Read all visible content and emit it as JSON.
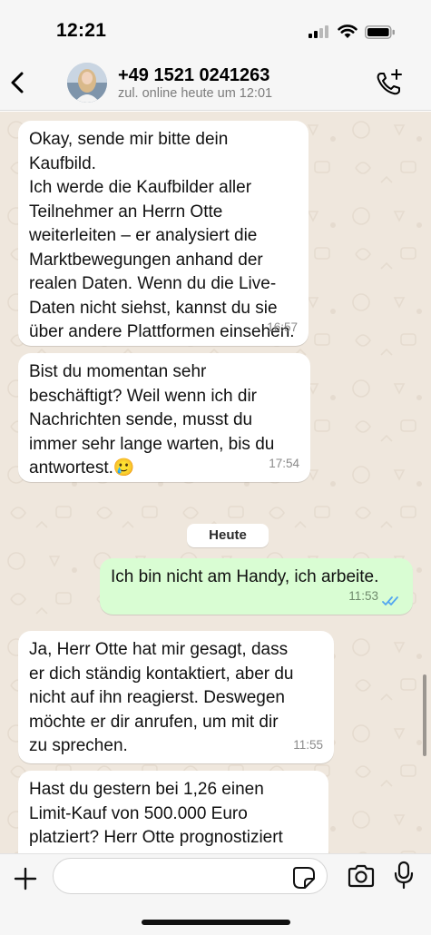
{
  "status_bar": {
    "time": "12:21",
    "icons": [
      "signal-icon",
      "wifi-icon",
      "battery-icon"
    ]
  },
  "header": {
    "name": "+49 1521 0241263",
    "status": "zul. online heute um 12:01",
    "icons": [
      "back-icon",
      "avatar",
      "call-add-icon"
    ]
  },
  "messages": [
    {
      "direction": "in",
      "text": "Okay, sende mir bitte dein Kaufbild.\nIch werde die Kaufbilder aller\nTeilnehmer an Herrn Otte\nweiterleiten – er analysiert die\nMarktbewegungen anhand der\nrealen Daten. Wenn du die Live-\nDaten nicht siehst, kannst du sie\nüber andere Plattformen einsehen.",
      "time": "16:57"
    },
    {
      "direction": "in",
      "text": "Bist du momentan sehr\nbeschäftigt? Weil wenn ich dir\nNachrichten sende, musst du\nimmer sehr lange warten, bis du\nantwortest.🥲",
      "time": "17:54"
    },
    {
      "direction": "out",
      "text": "Ich bin nicht am Handy, ich arbeite.",
      "time": "11:53",
      "read": true
    },
    {
      "direction": "in",
      "text": "Ja, Herr Otte hat mir gesagt, dass\ner dich ständig kontaktiert, aber du\nnicht auf ihn reagierst. Deswegen\nmöchte er dir anrufen, um mit dir\nzu sprechen.",
      "time": "11:55"
    },
    {
      "direction": "in",
      "text": "Hast du gestern bei 1,26 einen\nLimit-Kauf von 500.000 Euro\nplatziert? Herr Otte prognostiziert",
      "time": ""
    }
  ],
  "date_separator": "Heute",
  "input": {
    "placeholder": "",
    "value": ""
  },
  "colors": {
    "chat_background": "#efe7dd",
    "incoming_bubble": "#ffffff",
    "outgoing_bubble": "#d9fdd3",
    "read_ticks": "#53a6f0"
  }
}
